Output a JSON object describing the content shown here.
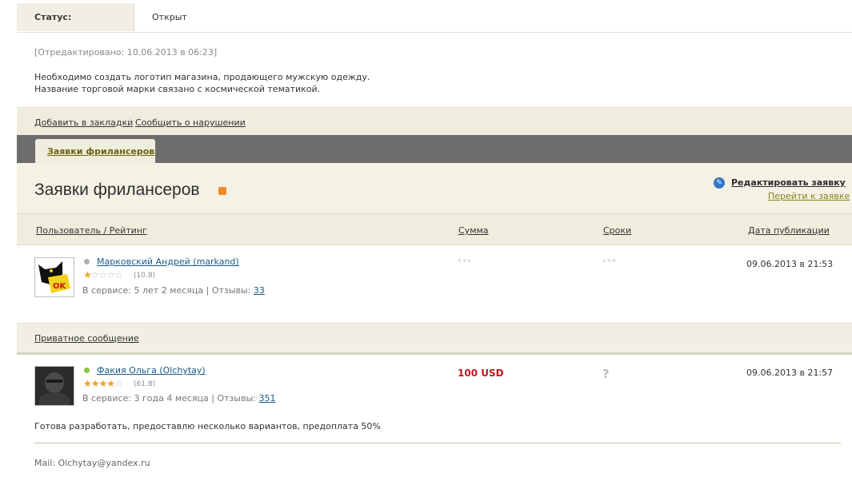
{
  "status": {
    "label": "Статус:",
    "value": "Открыт"
  },
  "edited": "[Отредактировано: 10.06.2013 в 06:23]",
  "description": [
    "Необходимо создать логотип магазина, продающего мужскую одежду.",
    "Название торговой марки связано с космической тематикой."
  ],
  "actions": {
    "bookmark": "Добавить в закладки",
    "separator": "|",
    "report": "Сообщить о нарушении"
  },
  "tab": {
    "label": "Заявки фрилансеров"
  },
  "section": {
    "title": "Заявки фрилансеров",
    "edit_label": "Редактировать заявку",
    "goto_label": "Перейти к заявке"
  },
  "table": {
    "headers": [
      "Пользователь / Рейтинг",
      "Сумма",
      "Сроки",
      "Дата публикации"
    ]
  },
  "bids": [
    {
      "name": "Марковский Андрей (markand)",
      "status_color": "#b0b0b0",
      "stars": 1,
      "rating": "(10.8)",
      "service_text": "В сервисе: 5 лет 2 месяца | Отзывы:",
      "reviews": "33",
      "sum": "***",
      "term": "***",
      "date": "09.06.2013 в 21:53"
    },
    {
      "name": "Факия Ольга (Olchytay)",
      "status_color": "#8ac43f",
      "stars": 4,
      "rating": "(61.8)",
      "service_text": "В сервисе: 3 года 4 месяца | Отзывы:",
      "reviews": "351",
      "sum": "100 USD",
      "term": "?",
      "date": "09.06.2013 в 21:57",
      "comment": "Готова разработать, предоставлю несколько вариантов, предоплата 50%",
      "mail": "Mail: Olchytay@yandex.ru"
    }
  ],
  "private_message": "Приватное сообщение",
  "colors": {
    "accent_link": "#1a5a86",
    "price": "#c3151b",
    "tab_bar": "#6d6d6d",
    "panel": "#efedde"
  }
}
